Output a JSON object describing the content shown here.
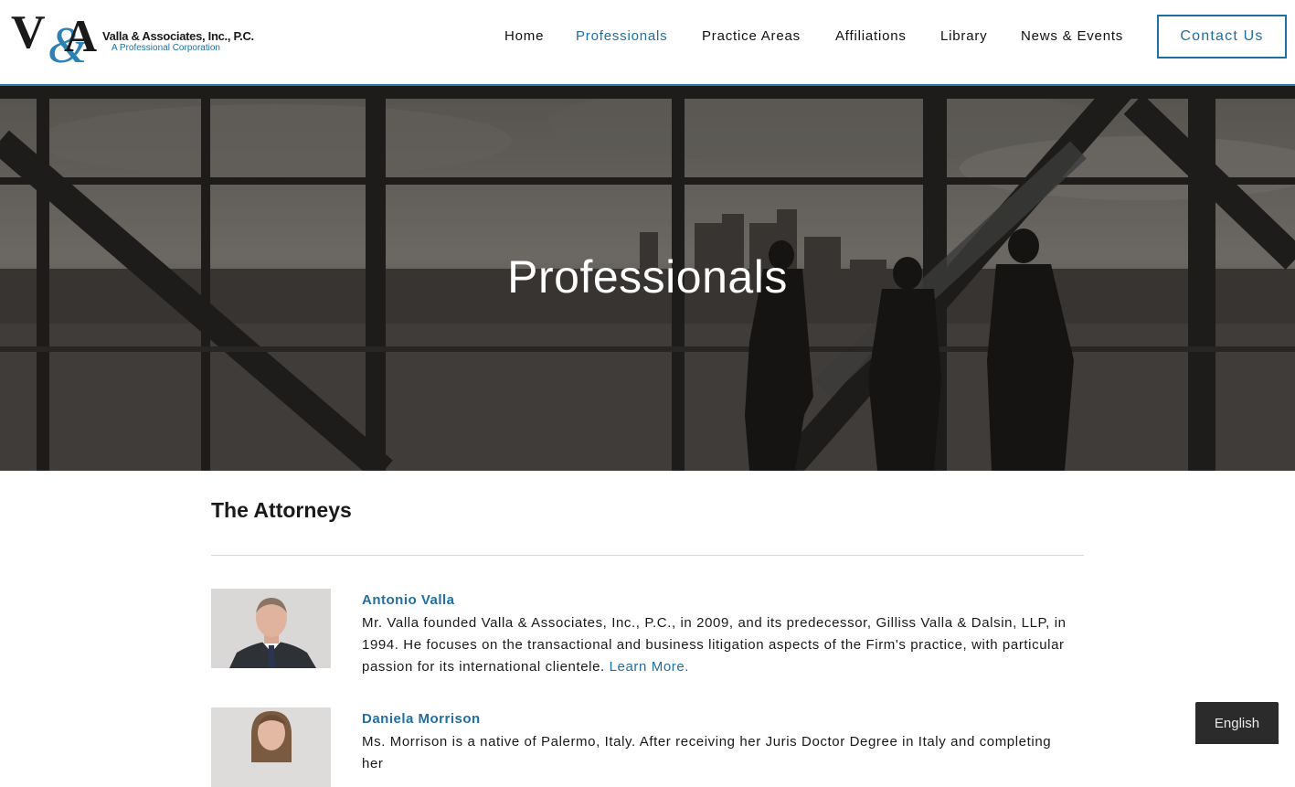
{
  "brand": {
    "logo_mark": "V&A",
    "name": "Valla & Associates, Inc., P.C.",
    "tagline": "A Professional Corporation",
    "accent_color": "#1f6fa3"
  },
  "nav": {
    "items": [
      {
        "label": "Home",
        "active": false
      },
      {
        "label": "Professionals",
        "active": true
      },
      {
        "label": "Practice Areas",
        "active": false
      },
      {
        "label": "Affiliations",
        "active": false
      },
      {
        "label": "Library",
        "active": false
      },
      {
        "label": "News & Events",
        "active": false
      }
    ],
    "contact_label": "Contact Us"
  },
  "hero": {
    "title": "Professionals"
  },
  "main": {
    "section_title": "The Attorneys",
    "attorneys": [
      {
        "name": "Antonio Valla",
        "bio": "Mr. Valla founded Valla & Associates, Inc., P.C., in 2009, and its predecessor, Gilliss Valla & Dalsin, LLP, in 1994. He focuses on the transactional and business litigation aspects of the Firm's practice, with particular passion for its international clientele.",
        "link_label": "Learn More."
      },
      {
        "name": "Daniela Morrison",
        "bio": "Ms. Morrison is a native of Palermo, Italy. After receiving her Juris Doctor Degree in Italy and completing her",
        "link_label": ""
      }
    ]
  },
  "language": {
    "current": "English"
  }
}
